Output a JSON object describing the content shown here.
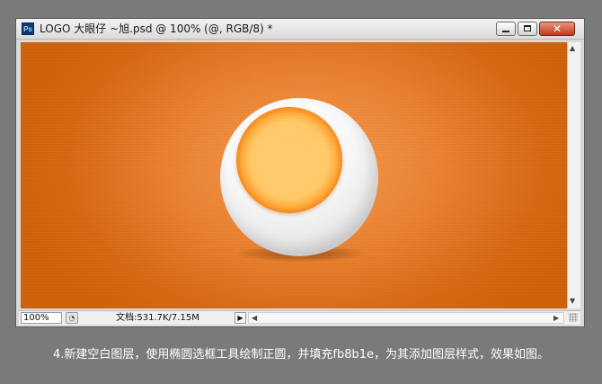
{
  "window": {
    "app_icon": "Ps",
    "title": "LOGO 大眼仔 ~旭.psd @ 100% (@, RGB/8) *",
    "buttons": {
      "minimize": "minimize-icon",
      "maximize": "maximize-icon",
      "close": "✕"
    }
  },
  "canvas": {
    "colors": {
      "background_center": "#f39a50",
      "background_edge": "#cd6008",
      "inner_fill": "#fb8b1e",
      "ring_core": "#ffcb70",
      "ball": "#f7f7f7"
    }
  },
  "status_bar": {
    "zoom": "100%",
    "doc_info": "文档:531.7K/7.15M",
    "menu_arrow": "▶",
    "scroll_left": "◀",
    "scroll_right": "▶"
  },
  "vertical_scroll": {
    "up": "▲",
    "down": "▼"
  },
  "caption": "4.新建空白图层，使用椭圆选框工具绘制正圆，并填充fb8b1e，为其添加图层样式，效果如图。"
}
